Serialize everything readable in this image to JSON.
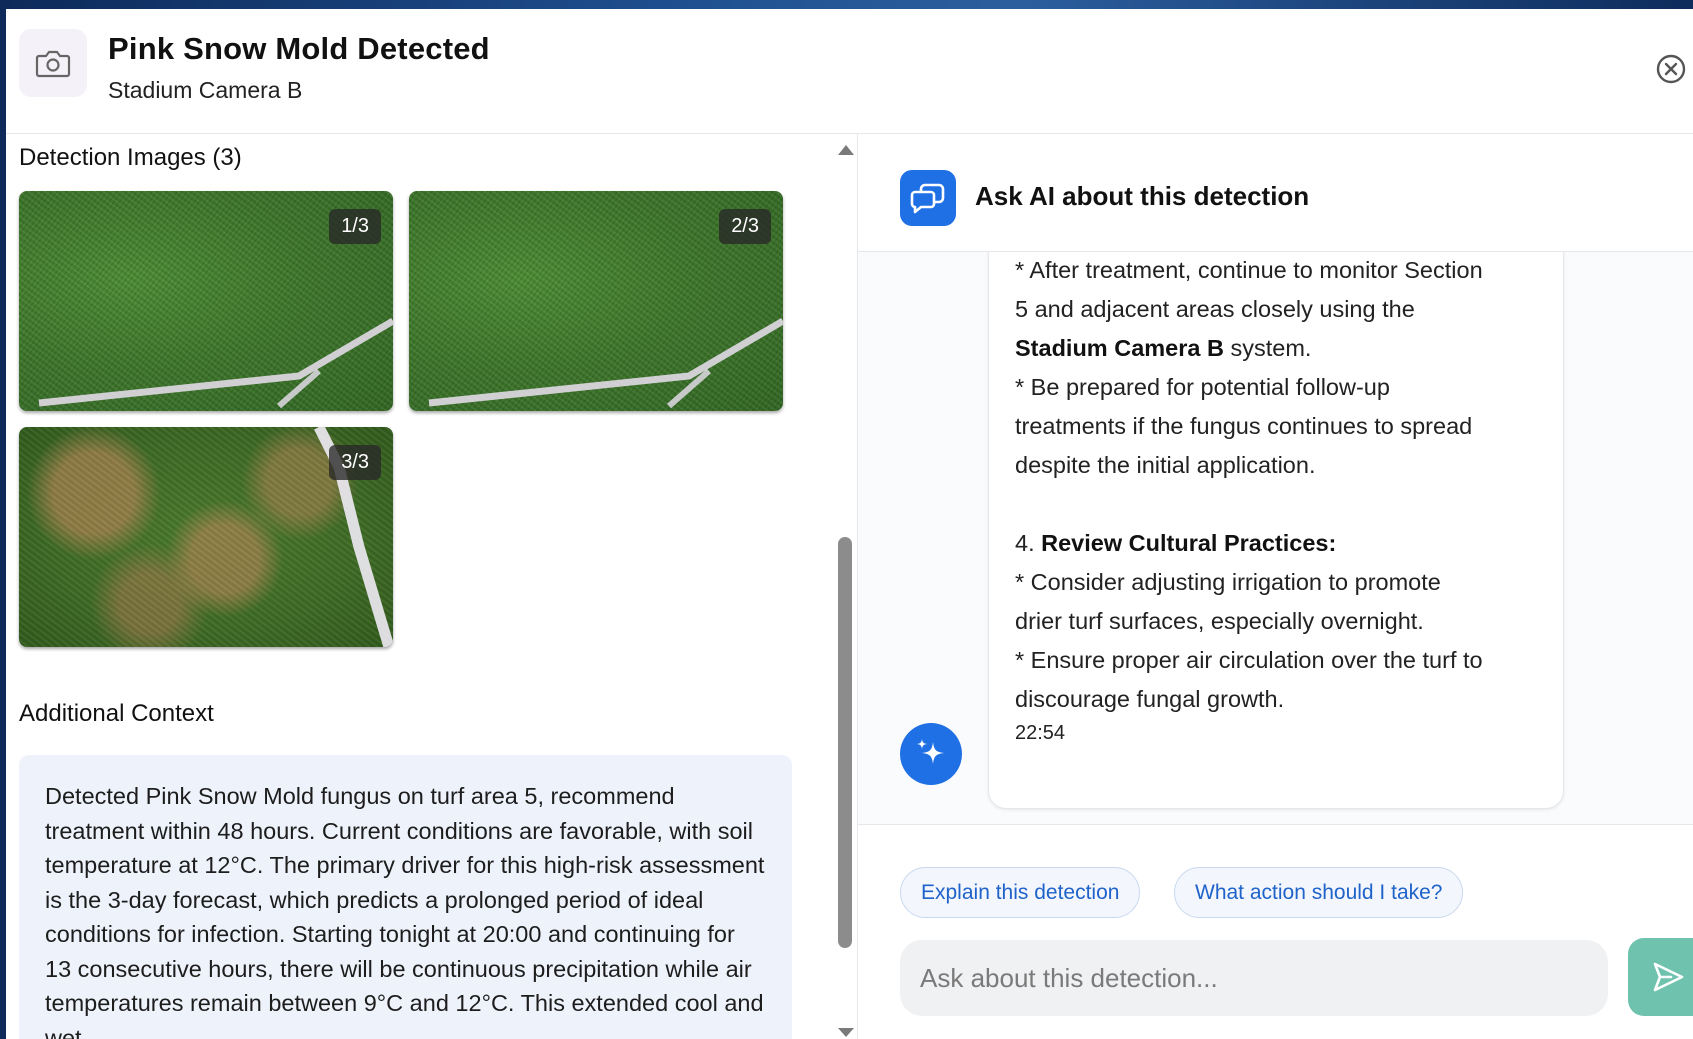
{
  "header": {
    "title": "Pink Snow Mold Detected",
    "subtitle": "Stadium Camera B",
    "camera_icon": "camera-icon",
    "close_icon": "close-circle-icon"
  },
  "left": {
    "images_title": "Detection Images (3)",
    "images": [
      {
        "badge": "1/3"
      },
      {
        "badge": "2/3"
      },
      {
        "badge": "3/3"
      }
    ],
    "context_title": "Additional Context",
    "context_text": "Detected Pink Snow Mold fungus on turf area 5, recommend treatment within 48 hours. Current conditions are favorable, with soil temperature at 12°C. The primary driver for this high-risk assessment is the 3-day forecast, which predicts a prolonged period of ideal conditions for infection. Starting tonight at 20:00 and continuing for 13 consecutive hours, there will be continuous precipitation while air temperatures remain between 9°C and 12°C. This extended cool and wet"
  },
  "ai": {
    "title": "Ask AI about this detection",
    "chat_icon": "chat-bubbles-icon",
    "bot_icon": "sparkles-icon",
    "message": {
      "l1": "* After treatment, continue to monitor Section",
      "l2": "5 and adjacent areas closely using the",
      "l3_bold": "Stadium Camera B",
      "l3_rest": " system.",
      "l4": "* Be prepared for potential follow-up",
      "l5": "treatments if the fungus continues to spread",
      "l6": "despite the initial application.",
      "l7_num": "4. ",
      "l7_bold": "Review Cultural Practices:",
      "l8": "* Consider adjusting irrigation to promote",
      "l9": "drier turf surfaces, especially overnight.",
      "l10": "* Ensure proper air circulation over the turf to",
      "l11": "discourage fungal growth.",
      "time": "22:54"
    },
    "chips": [
      "Explain this detection",
      "What action should I take?"
    ],
    "input_placeholder": "Ask about this detection...",
    "send_icon": "send-icon",
    "accent": "#1f6fe5",
    "send_color": "#6fc3ae"
  }
}
